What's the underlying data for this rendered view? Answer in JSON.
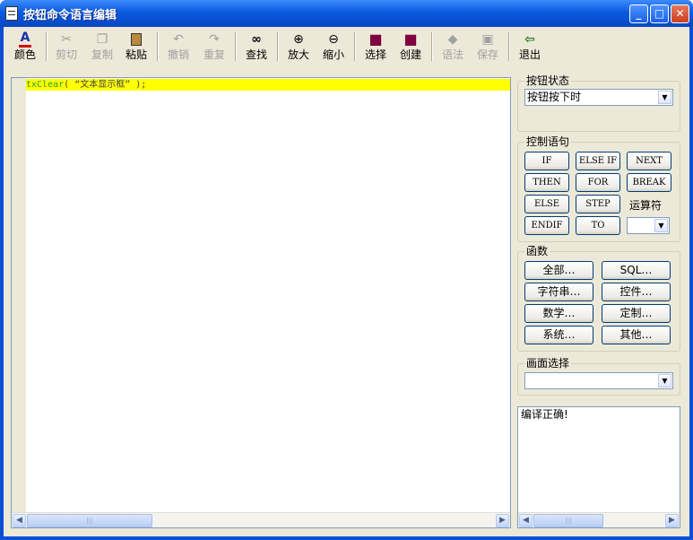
{
  "window": {
    "title": "按钮命令语言编辑",
    "min": "_",
    "max": "□",
    "close": "✕"
  },
  "toolbar": [
    {
      "id": "color",
      "label": "颜色",
      "icon": "A",
      "enabled": true
    },
    {
      "id": "cut",
      "label": "剪切",
      "icon": "✂",
      "enabled": false
    },
    {
      "id": "copy",
      "label": "复制",
      "icon": "❐",
      "enabled": false
    },
    {
      "id": "paste",
      "label": "粘贴",
      "icon": "📋",
      "enabled": true
    },
    {
      "id": "undo",
      "label": "撤销",
      "icon": "↶",
      "enabled": false
    },
    {
      "id": "redo",
      "label": "重复",
      "icon": "↷",
      "enabled": false
    },
    {
      "id": "find",
      "label": "查找",
      "icon": "🔭",
      "enabled": true
    },
    {
      "id": "zoom-in",
      "label": "放大",
      "icon": "⊕",
      "enabled": true
    },
    {
      "id": "zoom-out",
      "label": "缩小",
      "icon": "⊖",
      "enabled": true
    },
    {
      "id": "select",
      "label": "选择",
      "icon": "■",
      "enabled": true
    },
    {
      "id": "create",
      "label": "创建",
      "icon": "■",
      "enabled": true
    },
    {
      "id": "syntax",
      "label": "语法",
      "icon": "◆",
      "enabled": false
    },
    {
      "id": "save",
      "label": "保存",
      "icon": "▣",
      "enabled": false
    },
    {
      "id": "exit",
      "label": "退出",
      "icon": "⇦",
      "enabled": true
    }
  ],
  "editor": {
    "func": "txClear",
    "open": "( ",
    "arg": "“文本显示框”",
    "close": " );",
    "hthumb": "|||"
  },
  "panel": {
    "button_state": {
      "title": "按钮状态",
      "value": "按钮按下时"
    },
    "control": {
      "title": "控制语句",
      "buttons": [
        "IF",
        "ELSE IF",
        "NEXT",
        "THEN",
        "FOR",
        "BREAK",
        "ELSE",
        "STEP",
        "ENDIF",
        "TO"
      ],
      "operator_label": "运算符",
      "operator_value": ""
    },
    "functions": {
      "title": "函数",
      "buttons": [
        "全部…",
        "SQL…",
        "字符串…",
        "控件…",
        "数学…",
        "定制…",
        "系统…",
        "其他…"
      ]
    },
    "screen": {
      "title": "画面选择",
      "value": ""
    },
    "status": {
      "text": "编译正确!"
    }
  },
  "colors": {
    "highlight": "#ffff00",
    "keyword": "#2aa02a",
    "titlebar": "#0a5ae0"
  }
}
